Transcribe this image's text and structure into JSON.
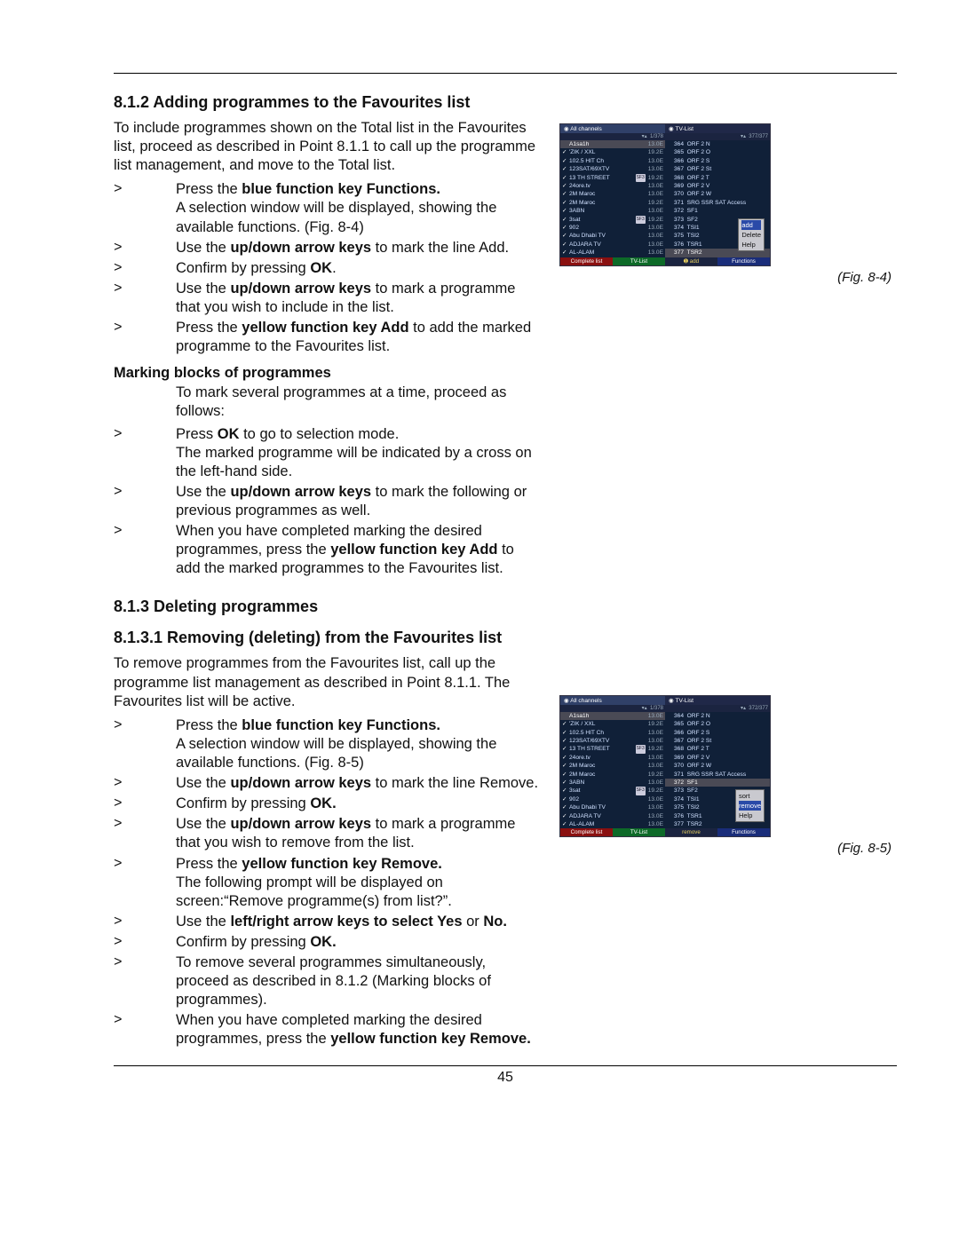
{
  "page_number": "45",
  "sections": {
    "s812_title": "8.1.2 Adding programmes to the Favourites list",
    "s812_intro": "To include programmes shown on the Total list in the Favourites list, proceed as described in Point 8.1.1 to call up the programme list management, and move to the Total list.",
    "s812_items": [
      "Press the <b>blue function key Functions.</b><br>A selection window will be displayed, showing the available functions. (Fig. 8-4)",
      "Use the <b>up/down arrow keys</b> to mark the line Add.",
      "Confirm by pressing <b>OK</b>.",
      "Use the <b>up/down arrow keys</b> to mark a programme that you wish to include in the list.",
      "Press the <b>yellow function key Add</b> to add the marked programme to the Favourites list."
    ],
    "s812_sub": "Marking blocks of programmes",
    "s812_sub_intro": "To mark several programmes at a time, proceed as follows:",
    "s812_sub_items": [
      "Press <b>OK</b> to go to selection mode.<br>The marked programme will be indicated by a cross on the left-hand side.",
      "Use the <b>up/down arrow keys</b> to mark the following or previous programmes as well.",
      "When you have completed marking the desired programmes, press the <b>yellow function key Add</b> to add the marked programmes to the Favourites list."
    ],
    "s813_title": "8.1.3 Deleting programmes",
    "s8131_title": "8.1.3.1 Removing (deleting) from the Favourites list",
    "s8131_intro": "To remove programmes from the Favourites list, call up the programme list management as described in Point 8.1.1. The Favourites list will be active.",
    "s8131_items": [
      "Press the <b>blue function key Functions.</b><br>A selection window will be displayed, showing the available functions. (Fig. 8-5)",
      "Use the <b>up/down arrow keys</b> to mark the line Remove.",
      "Confirm by pressing <b>OK.</b>",
      "Use the <b>up/down arrow keys</b> to mark a programme that you wish to remove from the list.",
      "Press the <b>yellow function key Remove.</b><br>The following prompt will be displayed on screen:“Remove programme(s) from list?”.",
      "Use the <b>left/right arrow keys to select Yes</b> or <b>No.</b>",
      "Confirm by pressing <b>OK.</b>",
      "To remove several programmes simultaneously, proceed as described in 8.1.2 (Marking blocks of programmes).",
      "When you have completed marking the desired programmes, press the <b>yellow function key Remove.</b>"
    ]
  },
  "fig": {
    "cap1": "(Fig. 8-4)",
    "cap2": "(Fig. 8-5)",
    "header_all": "All channels",
    "header_tv": "TV-List",
    "count_left": "1/378",
    "count_right_a": "377/377",
    "count_right_b": "372/377",
    "left_rows": [
      {
        "c": "",
        "n": "A1sa1h",
        "e": "13.0E"
      },
      {
        "c": "✓",
        "n": "'ZIK / XXL",
        "e": "19.2E"
      },
      {
        "c": "✓",
        "n": "102.5 HIT Ch",
        "e": "13.0E"
      },
      {
        "c": "✓",
        "n": "123SAT/69XTV",
        "e": "13.0E"
      },
      {
        "c": "✓",
        "n": "13 TH STREET",
        "e": "19.2E",
        "b": "SF3"
      },
      {
        "c": "✓",
        "n": "24ore.tv",
        "e": "13.0E"
      },
      {
        "c": "✓",
        "n": "2M Maroc",
        "e": "13.0E"
      },
      {
        "c": "✓",
        "n": "2M Maroc",
        "e": "19.2E"
      },
      {
        "c": "✓",
        "n": "3ABN",
        "e": "13.0E"
      },
      {
        "c": "✓",
        "n": "3sat",
        "e": "19.2E",
        "b": "SF3"
      },
      {
        "c": "✓",
        "n": "902",
        "e": "13.0E"
      },
      {
        "c": "✓",
        "n": "Abu Dhabi TV",
        "e": "13.0E"
      },
      {
        "c": "✓",
        "n": "ADJARA TV",
        "e": "13.0E"
      },
      {
        "c": "✓",
        "n": "AL-ALAM",
        "e": "13.0E"
      }
    ],
    "right_rows": [
      {
        "i": "364",
        "n": "ORF 2 N"
      },
      {
        "i": "365",
        "n": "ORF 2 O"
      },
      {
        "i": "366",
        "n": "ORF 2 S"
      },
      {
        "i": "367",
        "n": "ORF 2 St"
      },
      {
        "i": "368",
        "n": "ORF 2 T"
      },
      {
        "i": "369",
        "n": "ORF 2 V"
      },
      {
        "i": "370",
        "n": "ORF 2 W"
      },
      {
        "i": "371",
        "n": "SRG SSR SAT Access"
      },
      {
        "i": "372",
        "n": "SF1"
      },
      {
        "i": "373",
        "n": "SF2"
      },
      {
        "i": "374",
        "n": "TSI1"
      },
      {
        "i": "375",
        "n": "TSI2"
      },
      {
        "i": "376",
        "n": "TSR1"
      },
      {
        "i": "377",
        "n": "TSR2"
      }
    ],
    "menu1": [
      "add",
      "Delete",
      "Help"
    ],
    "menu2": [
      "sort",
      "remove",
      "Help"
    ],
    "footer": {
      "red": "Complete list",
      "grn": "TV-List",
      "yel_a": "➊ add",
      "yel_b": "remove",
      "blu": "Functions"
    }
  }
}
